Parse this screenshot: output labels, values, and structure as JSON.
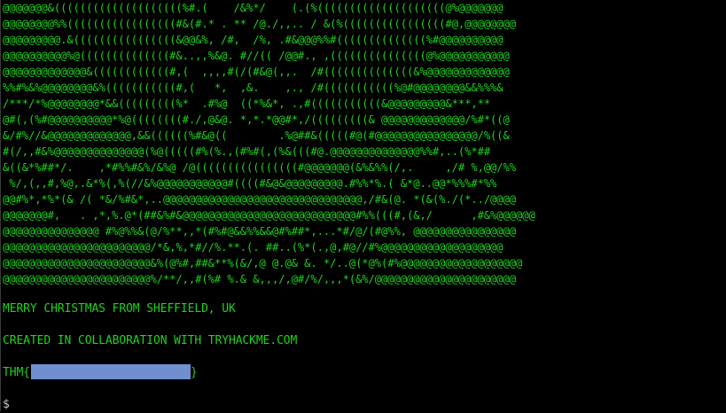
{
  "terminal": {
    "art_lines": [
      "@@@@@@@&((((((((((((((((((((%#.(    /&%*/    (.(%((((((((((((((((((((@%@@@@@@@",
      "@@@@@@@@%%(((((((((((((((((#&(#.* . ** /@./,,.. / &(%((((((((((((((((#@,@@@@@@@@",
      "@@@@@@@@@.&((((((((((((((((&@@&%, /#,  /%, .#&@@@%%#((((((((((((((%#@@@@@@@@@@",
      "@@@@@@@@@@%@((((((((((((((#&..,,%&@. #//(( /@@#., ,(((((((((((((((@%@@@@@@@@@@@",
      "@@@@@@@@@@@@@&((((((((((((#,(  ,,,,#(/(#&@(,,.  /#((((((((((((((&%@@@@@@@@@@@@@",
      "%%#%&%@@@@@@@@&%(((((((((((#,(   *,  ,&.    ,., /#(((((((((((%@#@@@@@@@@&&%%%&",
      "/***/*%@@@@@@@@*&&(((((((((%*  .#%@  ((*%&*, .,#(((((((((((&@@@@@@@@@&***,**",
      "@#(,(%#@@@@@@@@@@*%@((((((((#./,@&@. *,*.*@@#*,/(((((((((& @@@@@@@@@@@@@/%#*((@",
      "&/#%//&@@@@@@@@@@@@@,&&((((((%#&@((        .%@##&(((((#@(#@@@@@@@@@@@@@@@@/%((&",
      "#(/,,#&%@@@@@@@@@@@@@@(%@(((((#%(%.,(#%#(,(%&(((#@.@@@@@@@@@@@@@@%%#,..(%*##",
      "&((&*%##*/.    ,*#%%#&%/&%@ /@((((((((((((((((#@@@@@@@(&%&%%(/,.     ,/# %,@@/%%",
      " %/,(,,#,%@,.&*%(,%(//&%@@@@@@@@@@@#((((#&@&@@@@@@@@@.#%%*%.( &*@..@@*%%%#*%%",
      "@@#%*,*%*(& /( *&/%#&*,..@@@@@@@@@@@@@@@@@@@@@@@@@@@@@@@,/#&(@. *(&(%./(*../@@@@",
      "@@@@@@@#,   . ,*,%.@*(##&%#&@@@@@@@@@@@@@@@@@@@@@@@@@@@#%%(((#,(&,/      ,#&%@@@@@@",
      "@@@@@@@@@@@@@@@ #%@%%&(@/%**,,*(#%#@&&%%&&@#%##*,...*#/@/(#@%%, @@@@@@@@@@@@@@@@",
      "@@@@@@@@@@@@@@@@@@@@@@@/*&,%,*#//%.**.(. ##..(%*(.,@,#@//#%@@@@@@@@@@@@@@@@@@@",
      "@@@@@@@@@@@@@@@@@@@@@@@&%(@%#,##&**%(&/,@ @.@& &. */..@(*@%(#%@@@@@@@@@@@@@@@@@@@",
      "@@@@@@@@@@@@@@@@@@@@@@@%/**/,,#(%# %.& &,,,/,@#/%/,,,*(&%/@@@@@@@@@@@@@@@@@@@@@@"
    ],
    "message_1": "MERRY CHRISTMAS FROM SHEFFIELD, UK",
    "message_2": "CREATED IN COLLABORATION WITH TRYHACKME.COM",
    "flag_prefix": "THM{",
    "flag_suffix": "}",
    "prompt": "$",
    "text_color": "#1ed31e",
    "background_color": "#000000",
    "redaction_color": "#6f8fcf"
  }
}
